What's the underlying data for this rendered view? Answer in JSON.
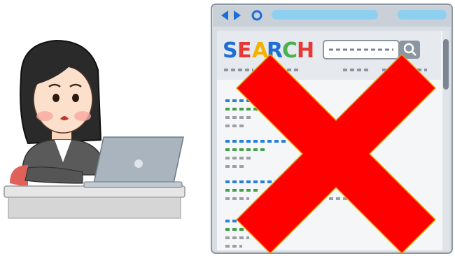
{
  "search_logo": {
    "letters": [
      {
        "char": "S",
        "color": "#1d6fd6"
      },
      {
        "char": "E",
        "color": "#e53935"
      },
      {
        "char": "A",
        "color": "#f6b100"
      },
      {
        "char": "R",
        "color": "#1d6fd6"
      },
      {
        "char": "C",
        "color": "#4caf50"
      },
      {
        "char": "H",
        "color": "#e53935"
      }
    ]
  },
  "colors": {
    "browser_frame": "#d9dee4",
    "browser_toolbar": "#c9d0d8",
    "address_bar": "#8fd0f0",
    "cross_mark": "#ff0000",
    "cross_outline": "#e0a000",
    "link_blue": "#2a7fd8",
    "snippet_green": "#43a047",
    "text_gray": "#9aa0a6",
    "desk": "#e6e6e6",
    "laptop": "#a9b4bf"
  },
  "icons": {
    "back": "back-arrow-icon",
    "forward": "forward-arrow-icon",
    "reload": "reload-icon",
    "search": "magnifier-icon",
    "blocked": "red-cross-icon"
  }
}
